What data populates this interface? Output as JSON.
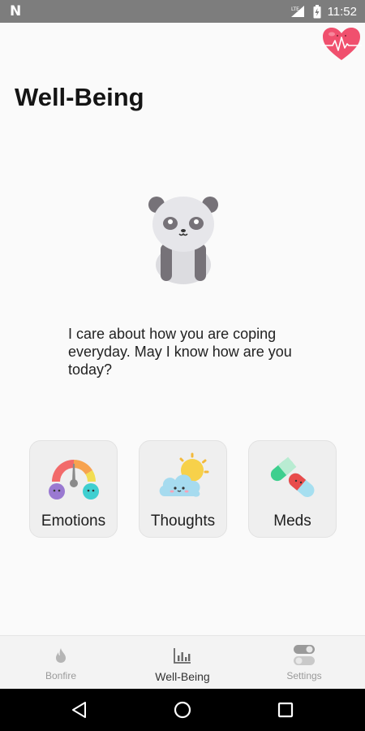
{
  "status_bar": {
    "left_icon": "n-notification-icon",
    "lte": "LTE",
    "time": "11:52"
  },
  "logo": {
    "icon": "heart-monitor-logo",
    "color": "#f0506e"
  },
  "page": {
    "title": "Well-Being",
    "mascot": "panda-mascot",
    "message": "I care about how you are coping everyday. May I know how are you today?"
  },
  "cards": [
    {
      "label": "Emotions",
      "icon": "emotion-gauge-icon"
    },
    {
      "label": "Thoughts",
      "icon": "cloud-sun-icon"
    },
    {
      "label": "Meds",
      "icon": "pills-icon"
    }
  ],
  "bottom_nav": {
    "items": [
      {
        "label": "Bonfire",
        "icon": "flame-icon",
        "active": false
      },
      {
        "label": "Well-Being",
        "icon": "bar-chart-icon",
        "active": true
      },
      {
        "label": "Settings",
        "icon": "toggle-icon",
        "active": false
      }
    ]
  },
  "system_nav": {
    "back": "back-icon",
    "home": "home-icon",
    "recent": "recent-apps-icon"
  }
}
